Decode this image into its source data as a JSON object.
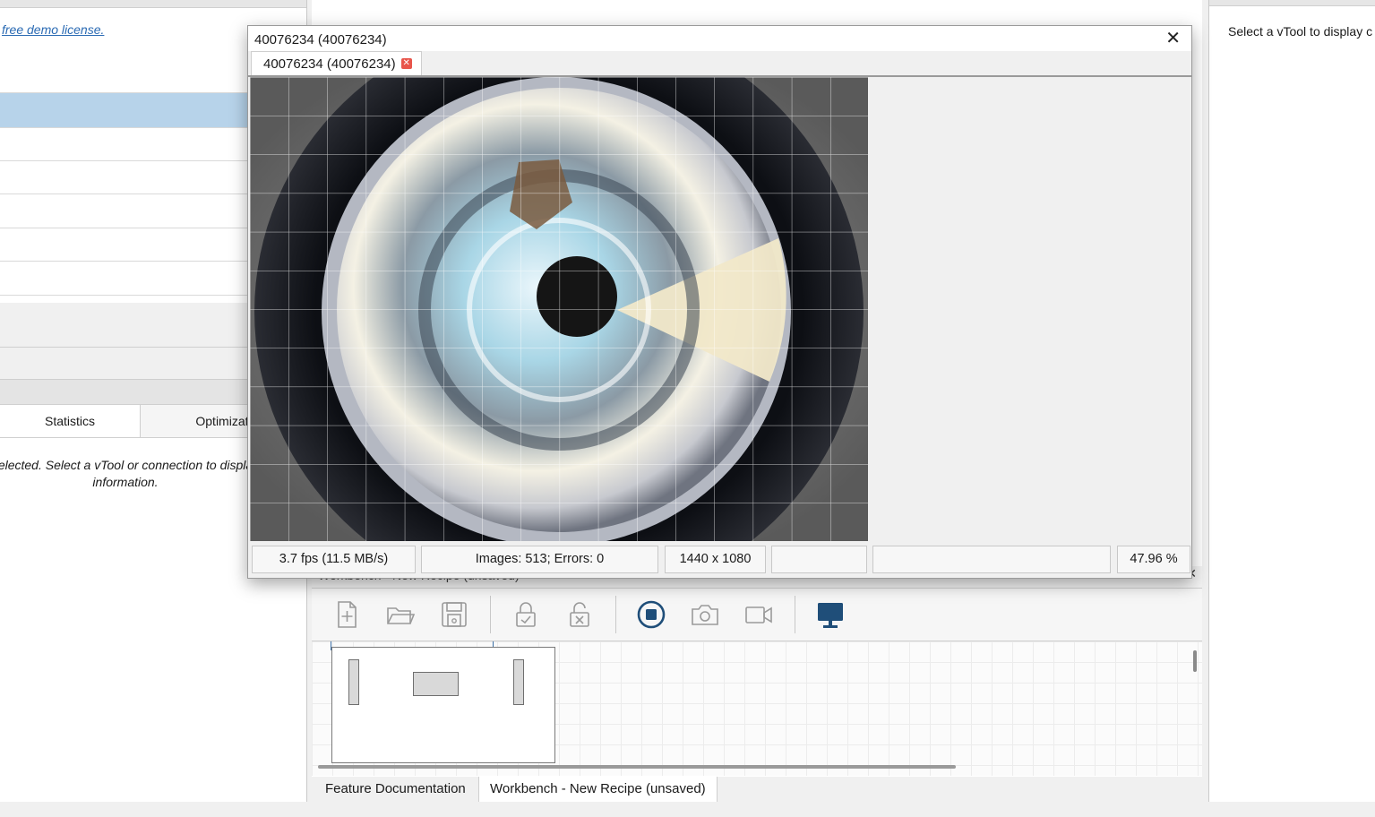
{
  "left_panel": {
    "demo_link": "free demo license.",
    "tabs": [
      {
        "label": "Statistics"
      },
      {
        "label": "Optimizati"
      }
    ],
    "no_selection_text": "elected. Select a vTool or connection to displa information."
  },
  "right_panel": {
    "hint": "Select a vTool to display c"
  },
  "camera_window": {
    "title": "40076234 (40076234)",
    "tab_label": "40076234 (40076234)",
    "close_glyph": "✕",
    "tab_close_glyph": "✕",
    "status": {
      "fps": "3.7 fps (11.5 MB/s)",
      "images": "Images: 513; Errors: 0",
      "resolution": "1440 x 1080",
      "zoom": "47.96 %"
    }
  },
  "workbench": {
    "title": "Workbench - New Recipe (unsaved)",
    "close_glyph": "✕",
    "toolbar": {
      "icons": [
        "new-recipe-icon",
        "open-folder-icon",
        "save-icon",
        "lock-icon",
        "unlock-icon",
        "stop-icon",
        "camera-icon",
        "video-icon",
        "monitor-icon"
      ],
      "accent_color": "#1f4e79"
    }
  },
  "bottom_tabs": [
    {
      "label": "Feature Documentation"
    },
    {
      "label": "Workbench - New Recipe (unsaved)"
    }
  ]
}
